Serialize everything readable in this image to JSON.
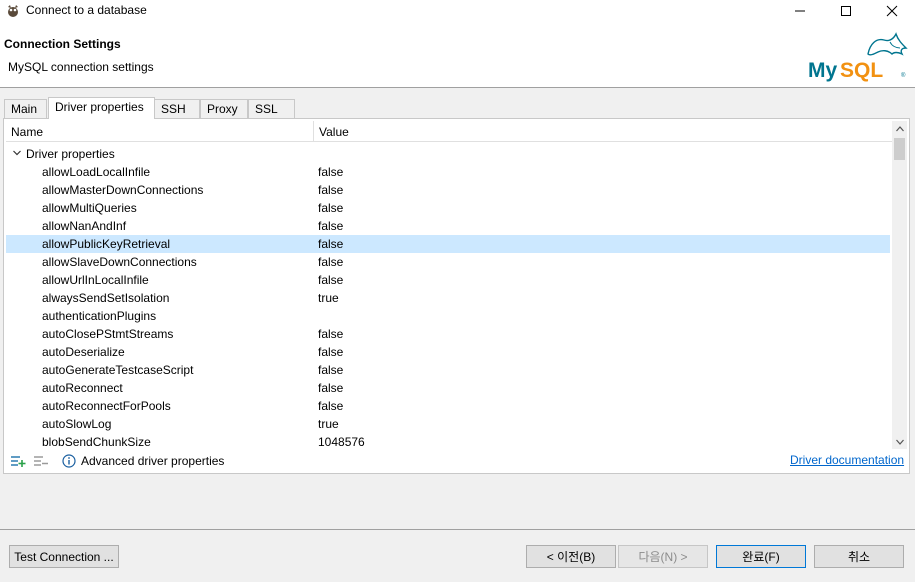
{
  "window": {
    "title": "Connect to a database"
  },
  "header": {
    "title": "Connection Settings",
    "subtitle": "MySQL connection settings",
    "logo_text": "MySQL"
  },
  "tabs": [
    {
      "label": "Main",
      "active": false
    },
    {
      "label": "Driver properties",
      "active": true
    },
    {
      "label": "SSH",
      "active": false
    },
    {
      "label": "Proxy",
      "active": false
    },
    {
      "label": "SSL",
      "active": false
    }
  ],
  "table": {
    "columns": {
      "name": "Name",
      "value": "Value"
    },
    "group": "Driver properties",
    "rows": [
      {
        "name": "allowLoadLocalInfile",
        "value": "false"
      },
      {
        "name": "allowMasterDownConnections",
        "value": "false"
      },
      {
        "name": "allowMultiQueries",
        "value": "false"
      },
      {
        "name": "allowNanAndInf",
        "value": "false"
      },
      {
        "name": "allowPublicKeyRetrieval",
        "value": "false",
        "selected": true
      },
      {
        "name": "allowSlaveDownConnections",
        "value": "false"
      },
      {
        "name": "allowUrlInLocalInfile",
        "value": "false"
      },
      {
        "name": "alwaysSendSetIsolation",
        "value": "true"
      },
      {
        "name": "authenticationPlugins",
        "value": ""
      },
      {
        "name": "autoClosePStmtStreams",
        "value": "false"
      },
      {
        "name": "autoDeserialize",
        "value": "false"
      },
      {
        "name": "autoGenerateTestcaseScript",
        "value": "false"
      },
      {
        "name": "autoReconnect",
        "value": "false"
      },
      {
        "name": "autoReconnectForPools",
        "value": "false"
      },
      {
        "name": "autoSlowLog",
        "value": "true"
      },
      {
        "name": "blobSendChunkSize",
        "value": "1048576"
      }
    ]
  },
  "panel_footer": {
    "advanced_text": "Advanced driver properties",
    "doc_link": "Driver documentation"
  },
  "buttons": {
    "test": "Test Connection ...",
    "back": "< 이전(B)",
    "next": "다음(N) >",
    "finish": "완료(F)",
    "cancel": "취소"
  },
  "colors": {
    "selection": "#cce8ff",
    "link": "#0066cc",
    "mysql_blue": "#00758f",
    "mysql_orange": "#f29111"
  }
}
